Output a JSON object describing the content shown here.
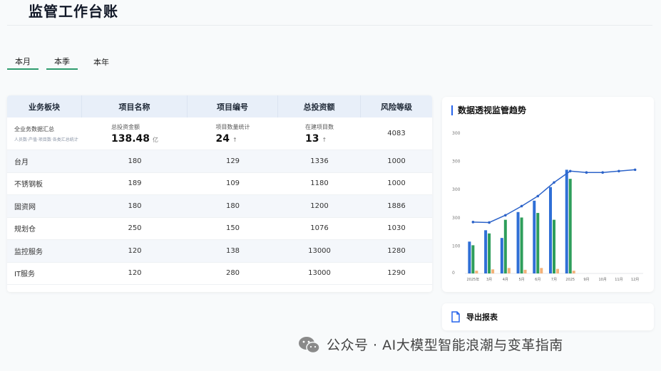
{
  "page": {
    "title": "监管工作台账"
  },
  "tabs": [
    {
      "label": "本月",
      "active": true
    },
    {
      "label": "本季",
      "active": true
    },
    {
      "label": "本年",
      "active": false
    }
  ],
  "table": {
    "headers": [
      "业务板块",
      "项目名称",
      "项目编号",
      "总投资额",
      "风险等级"
    ],
    "summary": {
      "col1_title": "全业务数据汇总",
      "col1_sub": "人员数·产值·项目数·各类汇总统计",
      "col2_label": "总投资金额",
      "col2_value": "138.48",
      "col2_unit": "亿",
      "col3_label": "项目数量统计",
      "col3_value": "24",
      "col3_arrow": "↑",
      "col4_label": "在建项目数",
      "col4_value": "13",
      "col4_arrow": "↑",
      "col5_value": "4083"
    },
    "rows": [
      [
        "台月",
        "180",
        "129",
        "1336",
        "1000"
      ],
      [
        "不锈钢板",
        "189",
        "109",
        "1180",
        "1000"
      ],
      [
        "固资网",
        "180",
        "180",
        "1200",
        "1886"
      ],
      [
        "规划仓",
        "250",
        "150",
        "1076",
        "1030"
      ],
      [
        "监控服务",
        "120",
        "138",
        "13000",
        "1280"
      ],
      [
        "IT服务",
        "120",
        "280",
        "13000",
        "1290"
      ]
    ]
  },
  "chart": {
    "title": "数据透视监管趋势",
    "colors": {
      "blue": "#2f6fd6",
      "green": "#2e9e5b",
      "orange": "#f2b27a",
      "line": "#2c63c9"
    }
  },
  "chart_data": {
    "type": "bar",
    "title": "数据透视监管趋势",
    "ytick_labels": [
      "300",
      "300",
      "300",
      "300",
      "100",
      "0"
    ],
    "xtick_labels": [
      "2025年",
      "3月",
      "4月",
      "5月",
      "6月",
      "7月",
      "2025",
      "9月",
      "10月",
      "11月",
      "12月"
    ],
    "series": [
      {
        "values": [
          70,
          95,
          78,
          135,
          160,
          190,
          228,
          0,
          0,
          0,
          0
        ]
      },
      {
        "values": [
          62,
          88,
          118,
          123,
          133,
          118,
          208,
          0,
          0,
          0,
          0
        ]
      },
      {
        "values": [
          6,
          9,
          12,
          8,
          12,
          10,
          6,
          0,
          0,
          0,
          0
        ]
      },
      {
        "values": [
          113,
          112,
          128,
          148,
          170,
          200,
          225,
          222,
          222,
          225,
          228
        ]
      }
    ],
    "ylim": [
      0,
      310
    ]
  },
  "export": {
    "label": "导出报表"
  },
  "watermark": {
    "text": "公众号 · AI大模型智能浪潮与变革指南"
  }
}
